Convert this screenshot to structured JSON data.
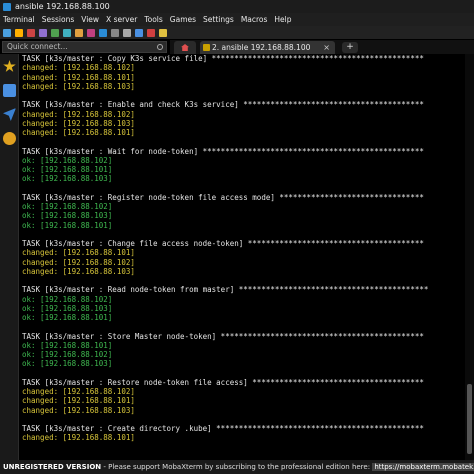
{
  "window": {
    "title": "ansible 192.168.88.100"
  },
  "menu": [
    "Terminal",
    "Sessions",
    "View",
    "X server",
    "Tools",
    "Games",
    "Settings",
    "Macros",
    "Help"
  ],
  "toolbar_icons": [
    {
      "name": "session-icon",
      "color": "#4aa0e0"
    },
    {
      "name": "servers-icon",
      "color": "#ffb000"
    },
    {
      "name": "tools-icon",
      "color": "#cc4444"
    },
    {
      "name": "games-icon",
      "color": "#9070d0"
    },
    {
      "name": "sessions-icon",
      "color": "#50a050"
    },
    {
      "name": "view-icon",
      "color": "#40b0c0"
    },
    {
      "name": "split-icon",
      "color": "#e0a040"
    },
    {
      "name": "multiexec-icon",
      "color": "#c04080"
    },
    {
      "name": "tunneling-icon",
      "color": "#2a8cd6"
    },
    {
      "name": "packages-icon",
      "color": "#888888"
    },
    {
      "name": "settings-icon",
      "color": "#aaaaaa"
    },
    {
      "name": "help-icon",
      "color": "#4a90e2"
    },
    {
      "name": "xserver-icon",
      "color": "#d04040"
    },
    {
      "name": "exit-icon",
      "color": "#e0c040"
    }
  ],
  "quick_connect": {
    "placeholder": "Quick connect..."
  },
  "tab": {
    "label": "2. ansible 192.168.88.100",
    "close": "×",
    "new": "+"
  },
  "sidebar_icons": [
    {
      "name": "star-icon",
      "color": "#e0b020"
    },
    {
      "name": "tools-icon",
      "color": "#4a90e2"
    },
    {
      "name": "send-icon",
      "color": "#3a80d0"
    },
    {
      "name": "macros-icon",
      "color": "#e0a020"
    }
  ],
  "terminal": {
    "lines": [
      {
        "cls": "task",
        "text": "TASK [k3s/master : Copy K3s service file] ***********************************************"
      },
      {
        "cls": "changed",
        "text": "changed: [192.168.88.102]"
      },
      {
        "cls": "changed",
        "text": "changed: [192.168.88.101]"
      },
      {
        "cls": "changed",
        "text": "changed: [192.168.88.103]"
      },
      {
        "cls": "task",
        "text": ""
      },
      {
        "cls": "task",
        "text": "TASK [k3s/master : Enable and check K3s service] ****************************************"
      },
      {
        "cls": "changed",
        "text": "changed: [192.168.88.102]"
      },
      {
        "cls": "changed",
        "text": "changed: [192.168.88.103]"
      },
      {
        "cls": "changed",
        "text": "changed: [192.168.88.101]"
      },
      {
        "cls": "task",
        "text": ""
      },
      {
        "cls": "task",
        "text": "TASK [k3s/master : Wait for node-token] *************************************************"
      },
      {
        "cls": "ok",
        "text": "ok: [192.168.88.102]"
      },
      {
        "cls": "ok",
        "text": "ok: [192.168.88.101]"
      },
      {
        "cls": "ok",
        "text": "ok: [192.168.88.103]"
      },
      {
        "cls": "task",
        "text": ""
      },
      {
        "cls": "task",
        "text": "TASK [k3s/master : Register node-token file access mode] ********************************"
      },
      {
        "cls": "ok",
        "text": "ok: [192.168.88.102]"
      },
      {
        "cls": "ok",
        "text": "ok: [192.168.88.103]"
      },
      {
        "cls": "ok",
        "text": "ok: [192.168.88.101]"
      },
      {
        "cls": "task",
        "text": ""
      },
      {
        "cls": "task",
        "text": "TASK [k3s/master : Change file access node-token] ***************************************"
      },
      {
        "cls": "changed",
        "text": "changed: [192.168.88.101]"
      },
      {
        "cls": "changed",
        "text": "changed: [192.168.88.102]"
      },
      {
        "cls": "changed",
        "text": "changed: [192.168.88.103]"
      },
      {
        "cls": "task",
        "text": ""
      },
      {
        "cls": "task",
        "text": "TASK [k3s/master : Read node-token from master] ******************************************"
      },
      {
        "cls": "ok",
        "text": "ok: [192.168.88.102]"
      },
      {
        "cls": "ok",
        "text": "ok: [192.168.88.103]"
      },
      {
        "cls": "ok",
        "text": "ok: [192.168.88.101]"
      },
      {
        "cls": "task",
        "text": ""
      },
      {
        "cls": "task",
        "text": "TASK [k3s/master : Store Master node-token] *********************************************"
      },
      {
        "cls": "ok",
        "text": "ok: [192.168.88.101]"
      },
      {
        "cls": "ok",
        "text": "ok: [192.168.88.102]"
      },
      {
        "cls": "ok",
        "text": "ok: [192.168.88.103]"
      },
      {
        "cls": "task",
        "text": ""
      },
      {
        "cls": "task",
        "text": "TASK [k3s/master : Restore node-token file access] **************************************"
      },
      {
        "cls": "changed",
        "text": "changed: [192.168.88.102]"
      },
      {
        "cls": "changed",
        "text": "changed: [192.168.88.101]"
      },
      {
        "cls": "changed",
        "text": "changed: [192.168.88.103]"
      },
      {
        "cls": "task",
        "text": ""
      },
      {
        "cls": "task",
        "text": "TASK [k3s/master : Create directory .kube] **********************************************"
      },
      {
        "cls": "changed",
        "text": "changed: [192.168.88.101]"
      }
    ]
  },
  "status": {
    "unregistered": "UNREGISTERED VERSION",
    "message": " -  Please support MobaXterm by subscribing to the professional edition here: ",
    "link": "https://mobaxterm.mobatek.net"
  }
}
